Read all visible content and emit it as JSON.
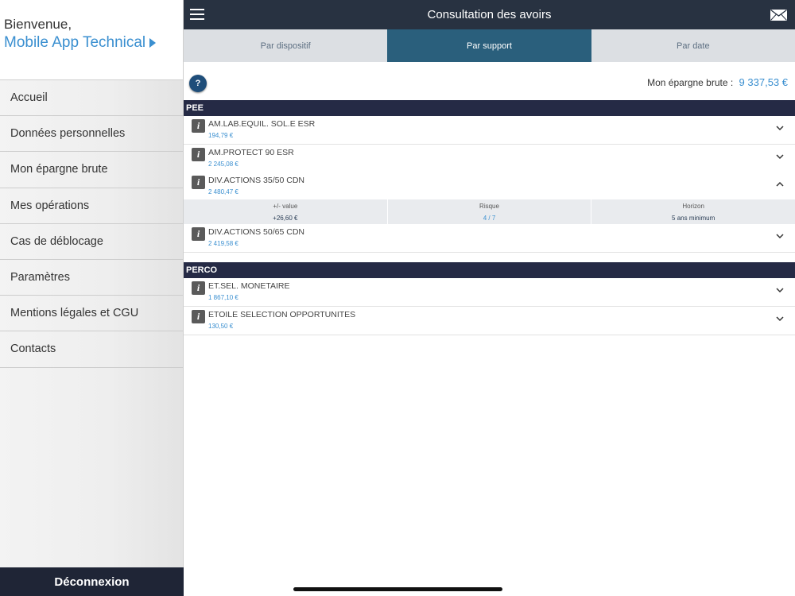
{
  "sidebar": {
    "greeting": "Bienvenue,",
    "user_name": "Mobile App Technical",
    "menu": [
      {
        "label": "Accueil"
      },
      {
        "label": "Données personnelles"
      },
      {
        "label": "Mon épargne brute"
      },
      {
        "label": "Mes opérations"
      },
      {
        "label": "Cas de déblocage"
      },
      {
        "label": "Paramètres"
      },
      {
        "label": "Mentions légales et CGU"
      },
      {
        "label": "Contacts"
      }
    ],
    "logout_label": "Déconnexion"
  },
  "header": {
    "title": "Consultation des avoirs",
    "menu_icon": "hamburger-icon",
    "mail_icon": "envelope-icon"
  },
  "tabs": [
    {
      "label": "Par dispositif",
      "active": false
    },
    {
      "label": "Par support",
      "active": true
    },
    {
      "label": "Par date",
      "active": false
    }
  ],
  "summary": {
    "help_label": "?",
    "savings_label": "Mon épargne brute :",
    "savings_value": "9 337,53 €"
  },
  "sections": [
    {
      "title": "PEE",
      "funds": [
        {
          "name": "AM.LAB.EQUIL. SOL.E ESR",
          "value": "194,79 €",
          "expanded": false
        },
        {
          "name": "AM.PROTECT 90 ESR",
          "value": "2 245,08 €",
          "expanded": false
        },
        {
          "name": "DIV.ACTIONS 35/50 CDN",
          "value": "2 480,47 €",
          "expanded": true
        },
        {
          "name": "DIV.ACTIONS 50/65 CDN",
          "value": "2 419,58 €",
          "expanded": false
        }
      ]
    },
    {
      "title": "PERCO",
      "funds": [
        {
          "name": "ET.SEL. MONETAIRE",
          "value": "1 867,10 €",
          "expanded": false
        },
        {
          "name": "ETOILE SELECTION OPPORTUNITES",
          "value": "130,50 €",
          "expanded": false
        }
      ]
    }
  ],
  "detail": {
    "plus_value_label": "+/- value",
    "plus_value": "+26,60 €",
    "risk_label": "Risque",
    "risk_value": "4 / 7",
    "horizon_label": "Horizon",
    "horizon_value": "5 ans minimum"
  },
  "colors": {
    "accent": "#3a8fd0",
    "topbar": "#283241",
    "active_tab": "#2a5f7c",
    "section_header": "#252a45"
  }
}
